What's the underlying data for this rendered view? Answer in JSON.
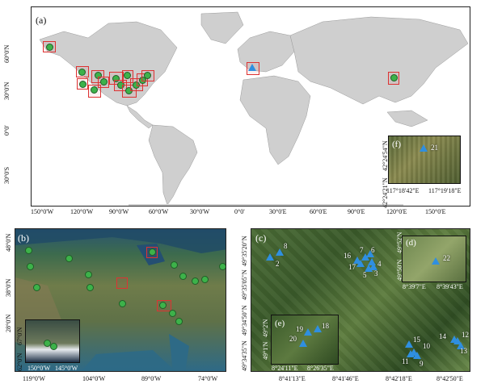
{
  "panel_a": {
    "label": "(a)",
    "lon_ticks": [
      "150°0'W",
      "120°0'W",
      "90°0'W",
      "60°0'W",
      "30°0'W",
      "0°0'",
      "30°0'E",
      "60°0'E",
      "90°0'E",
      "120°0'E",
      "150°0'E"
    ],
    "lat_ticks": [
      "60°0'N",
      "30°0'N",
      "0°0'",
      "30°0'S"
    ],
    "inset": {
      "label": "(f)",
      "site": "21",
      "lon_ticks": [
        "117°18'42\"E",
        "117°19'18\"E"
      ],
      "lat_ticks": [
        "42°24'54\"N",
        "42°24'21\"N"
      ]
    }
  },
  "panel_b": {
    "label": "(b)",
    "lon_ticks": [
      "119°0'W",
      "104°0'W",
      "89°0'W",
      "74°0'W"
    ],
    "lat_ticks": [
      "48°0'N",
      "38°0'N",
      "28°0'N"
    ],
    "inset": {
      "lon_ticks": [
        "150°0'W",
        "145°0'W"
      ],
      "lat_ticks": [
        "67°0'N",
        "62°0'N"
      ]
    }
  },
  "panel_c": {
    "label": "(c)",
    "lon_ticks": [
      "8°41'13\"E",
      "8°41'46\"E",
      "8°42'18\"E",
      "8°42'50\"E"
    ],
    "lat_ticks": [
      "49°35'20\"N",
      "49°35'05\"N",
      "49°34'50\"N",
      "49°34'35\"N"
    ],
    "sites": [
      "2",
      "8",
      "16",
      "7",
      "6",
      "17",
      "4",
      "5",
      "3",
      "15",
      "14",
      "12",
      "10",
      "11",
      "9",
      "13"
    ],
    "inset_d": {
      "label": "(d)",
      "site": "22",
      "lon_ticks": [
        "8°39'7\"E",
        "8°39'43\"E"
      ],
      "lat_ticks": [
        "49°52'N",
        "49°50'N"
      ]
    },
    "inset_e": {
      "label": "(e)",
      "sites": [
        "19",
        "18",
        "20"
      ],
      "lon_ticks": [
        "8°24'11\"E",
        "8°26'35\"E"
      ],
      "lat_ticks": [
        "49°2'N",
        "49°1'N"
      ]
    }
  },
  "colors": {
    "land": "#cfcfcf",
    "ocean": "#ffffff",
    "site_marker": "#3db24a",
    "triangle": "#2f8fe0",
    "box": "#d33333"
  }
}
